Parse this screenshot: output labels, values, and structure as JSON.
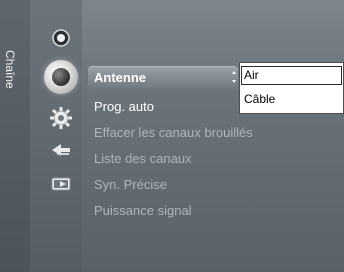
{
  "sidebar": {
    "tab_label": "Chaîne",
    "icons": [
      {
        "name": "picture-icon",
        "active": false
      },
      {
        "name": "channel-icon",
        "active": true
      },
      {
        "name": "setup-icon",
        "active": false
      },
      {
        "name": "input-icon",
        "active": false
      },
      {
        "name": "application-icon",
        "active": false
      }
    ]
  },
  "menu": {
    "items": [
      {
        "label": "Antenne",
        "state": "selected"
      },
      {
        "label": "Prog. auto",
        "state": "enabled"
      },
      {
        "label": "Effacer les canaux brouillés",
        "state": "disabled"
      },
      {
        "label": "Liste des canaux",
        "state": "disabled"
      },
      {
        "label": "Syn. Précise",
        "state": "disabled"
      },
      {
        "label": "Puissance signal",
        "state": "disabled"
      }
    ]
  },
  "dropdown": {
    "options": [
      {
        "label": "Air",
        "highlighted": true
      },
      {
        "label": "Câble",
        "highlighted": false
      }
    ]
  }
}
